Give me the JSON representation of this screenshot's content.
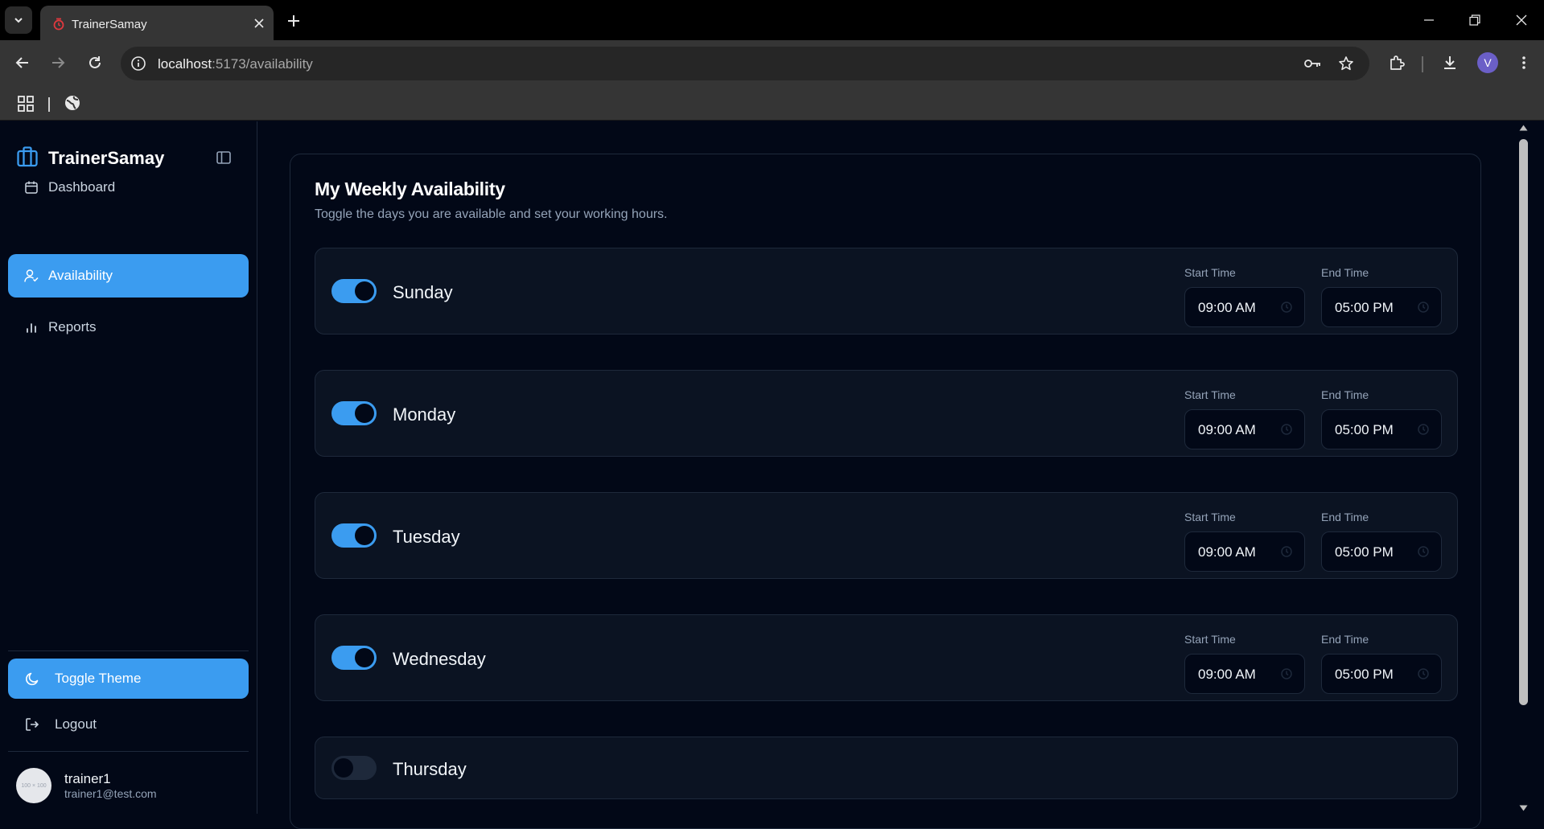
{
  "browser": {
    "tab_title": "TrainerSamay",
    "url_host": "localhost",
    "url_path": ":5173/availability",
    "profile_initial": "V"
  },
  "sidebar": {
    "brand": "TrainerSamay",
    "items": [
      {
        "label": "Dashboard",
        "icon": "calendar-icon",
        "active": false
      },
      {
        "label": "Availability",
        "icon": "user-check-icon",
        "active": true
      },
      {
        "label": "Reports",
        "icon": "bar-chart-icon",
        "active": false
      }
    ],
    "toggle_theme_label": "Toggle Theme",
    "logout_label": "Logout",
    "user": {
      "name": "trainer1",
      "email": "trainer1@test.com",
      "avatar_text": "100 × 100"
    }
  },
  "availability": {
    "title": "My Weekly Availability",
    "subtitle": "Toggle the days you are available and set your working hours.",
    "start_label": "Start Time",
    "end_label": "End Time",
    "days": [
      {
        "name": "Sunday",
        "enabled": true,
        "start": "09:00 AM",
        "end": "05:00 PM"
      },
      {
        "name": "Monday",
        "enabled": true,
        "start": "09:00 AM",
        "end": "05:00 PM"
      },
      {
        "name": "Tuesday",
        "enabled": true,
        "start": "09:00 AM",
        "end": "05:00 PM"
      },
      {
        "name": "Wednesday",
        "enabled": true,
        "start": "09:00 AM",
        "end": "05:00 PM"
      },
      {
        "name": "Thursday",
        "enabled": false
      }
    ]
  },
  "colors": {
    "accent": "#3b9cf0",
    "background": "#020817",
    "row_background": "#0b1322",
    "border": "#1e293b"
  }
}
